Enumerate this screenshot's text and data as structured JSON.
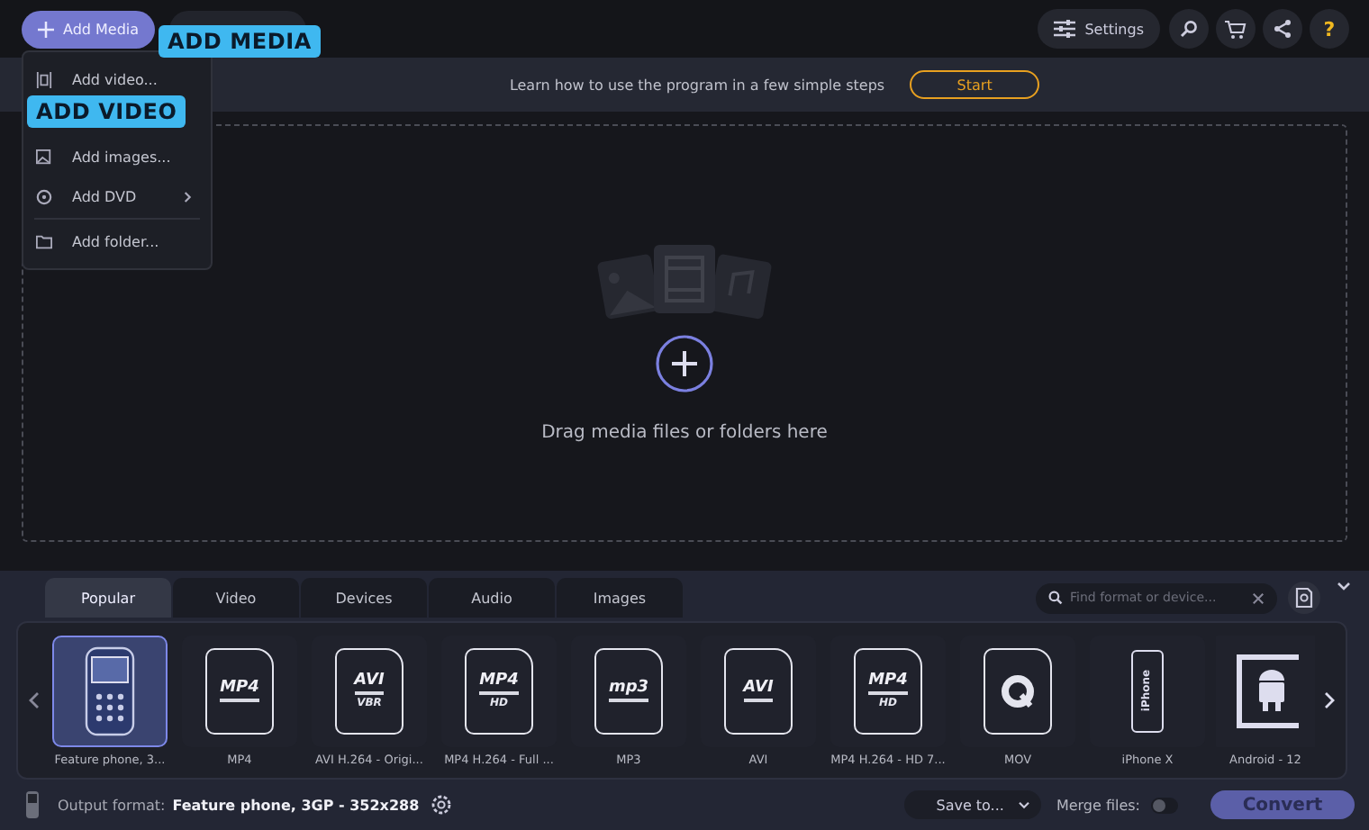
{
  "toolbar": {
    "add_media": "Add Media",
    "settings": "Settings",
    "help": "?"
  },
  "add_menu": [
    {
      "label": "Add video...",
      "kind": "video",
      "submenu": false
    },
    {
      "label": "Add images...",
      "kind": "image",
      "submenu": false
    },
    {
      "label": "Add DVD",
      "kind": "dvd",
      "submenu": true
    },
    {
      "label": "Add folder...",
      "kind": "folder",
      "submenu": false
    }
  ],
  "callouts": [
    {
      "text": "ADD MEDIA"
    },
    {
      "text": "ADD VIDEO"
    }
  ],
  "tip_bar": {
    "text": "Learn how to use the program in a few simple steps",
    "button": "Start"
  },
  "drop_zone": {
    "text": "Drag media files or folders here"
  },
  "format_tabs": [
    {
      "label": "Popular",
      "selected": true
    },
    {
      "label": "Video",
      "selected": false
    },
    {
      "label": "Devices",
      "selected": false
    },
    {
      "label": "Audio",
      "selected": false
    },
    {
      "label": "Images",
      "selected": false
    }
  ],
  "format_search": {
    "placeholder": "Find format or device..."
  },
  "formats": [
    {
      "label": "Feature phone, 3...",
      "kind": "phone",
      "selected": true
    },
    {
      "label": "MP4",
      "kind": "doc",
      "badge": "MP4",
      "selected": false
    },
    {
      "label": "AVI H.264 - Origi...",
      "kind": "doc",
      "badge": "AVI",
      "sub": "VBR",
      "selected": false
    },
    {
      "label": "MP4 H.264 - Full ...",
      "kind": "doc",
      "badge": "MP4",
      "sub": "HD",
      "selected": false
    },
    {
      "label": "MP3",
      "kind": "doc",
      "badge": "mp3",
      "selected": false
    },
    {
      "label": "AVI",
      "kind": "doc",
      "badge": "AVI",
      "selected": false
    },
    {
      "label": "MP4 H.264 - HD 7...",
      "kind": "doc",
      "badge": "MP4",
      "sub": "HD",
      "selected": false
    },
    {
      "label": "MOV",
      "kind": "mov",
      "selected": false
    },
    {
      "label": "iPhone X",
      "kind": "iphone",
      "badge": "iPhone",
      "selected": false
    },
    {
      "label": "Android - 12",
      "kind": "android",
      "selected": false
    }
  ],
  "footer": {
    "output_label": "Output format:",
    "output_value": "Feature phone, 3GP - 352x288",
    "save_to": "Save to...",
    "merge_label": "Merge files:",
    "merge_on": false,
    "convert": "Convert"
  }
}
